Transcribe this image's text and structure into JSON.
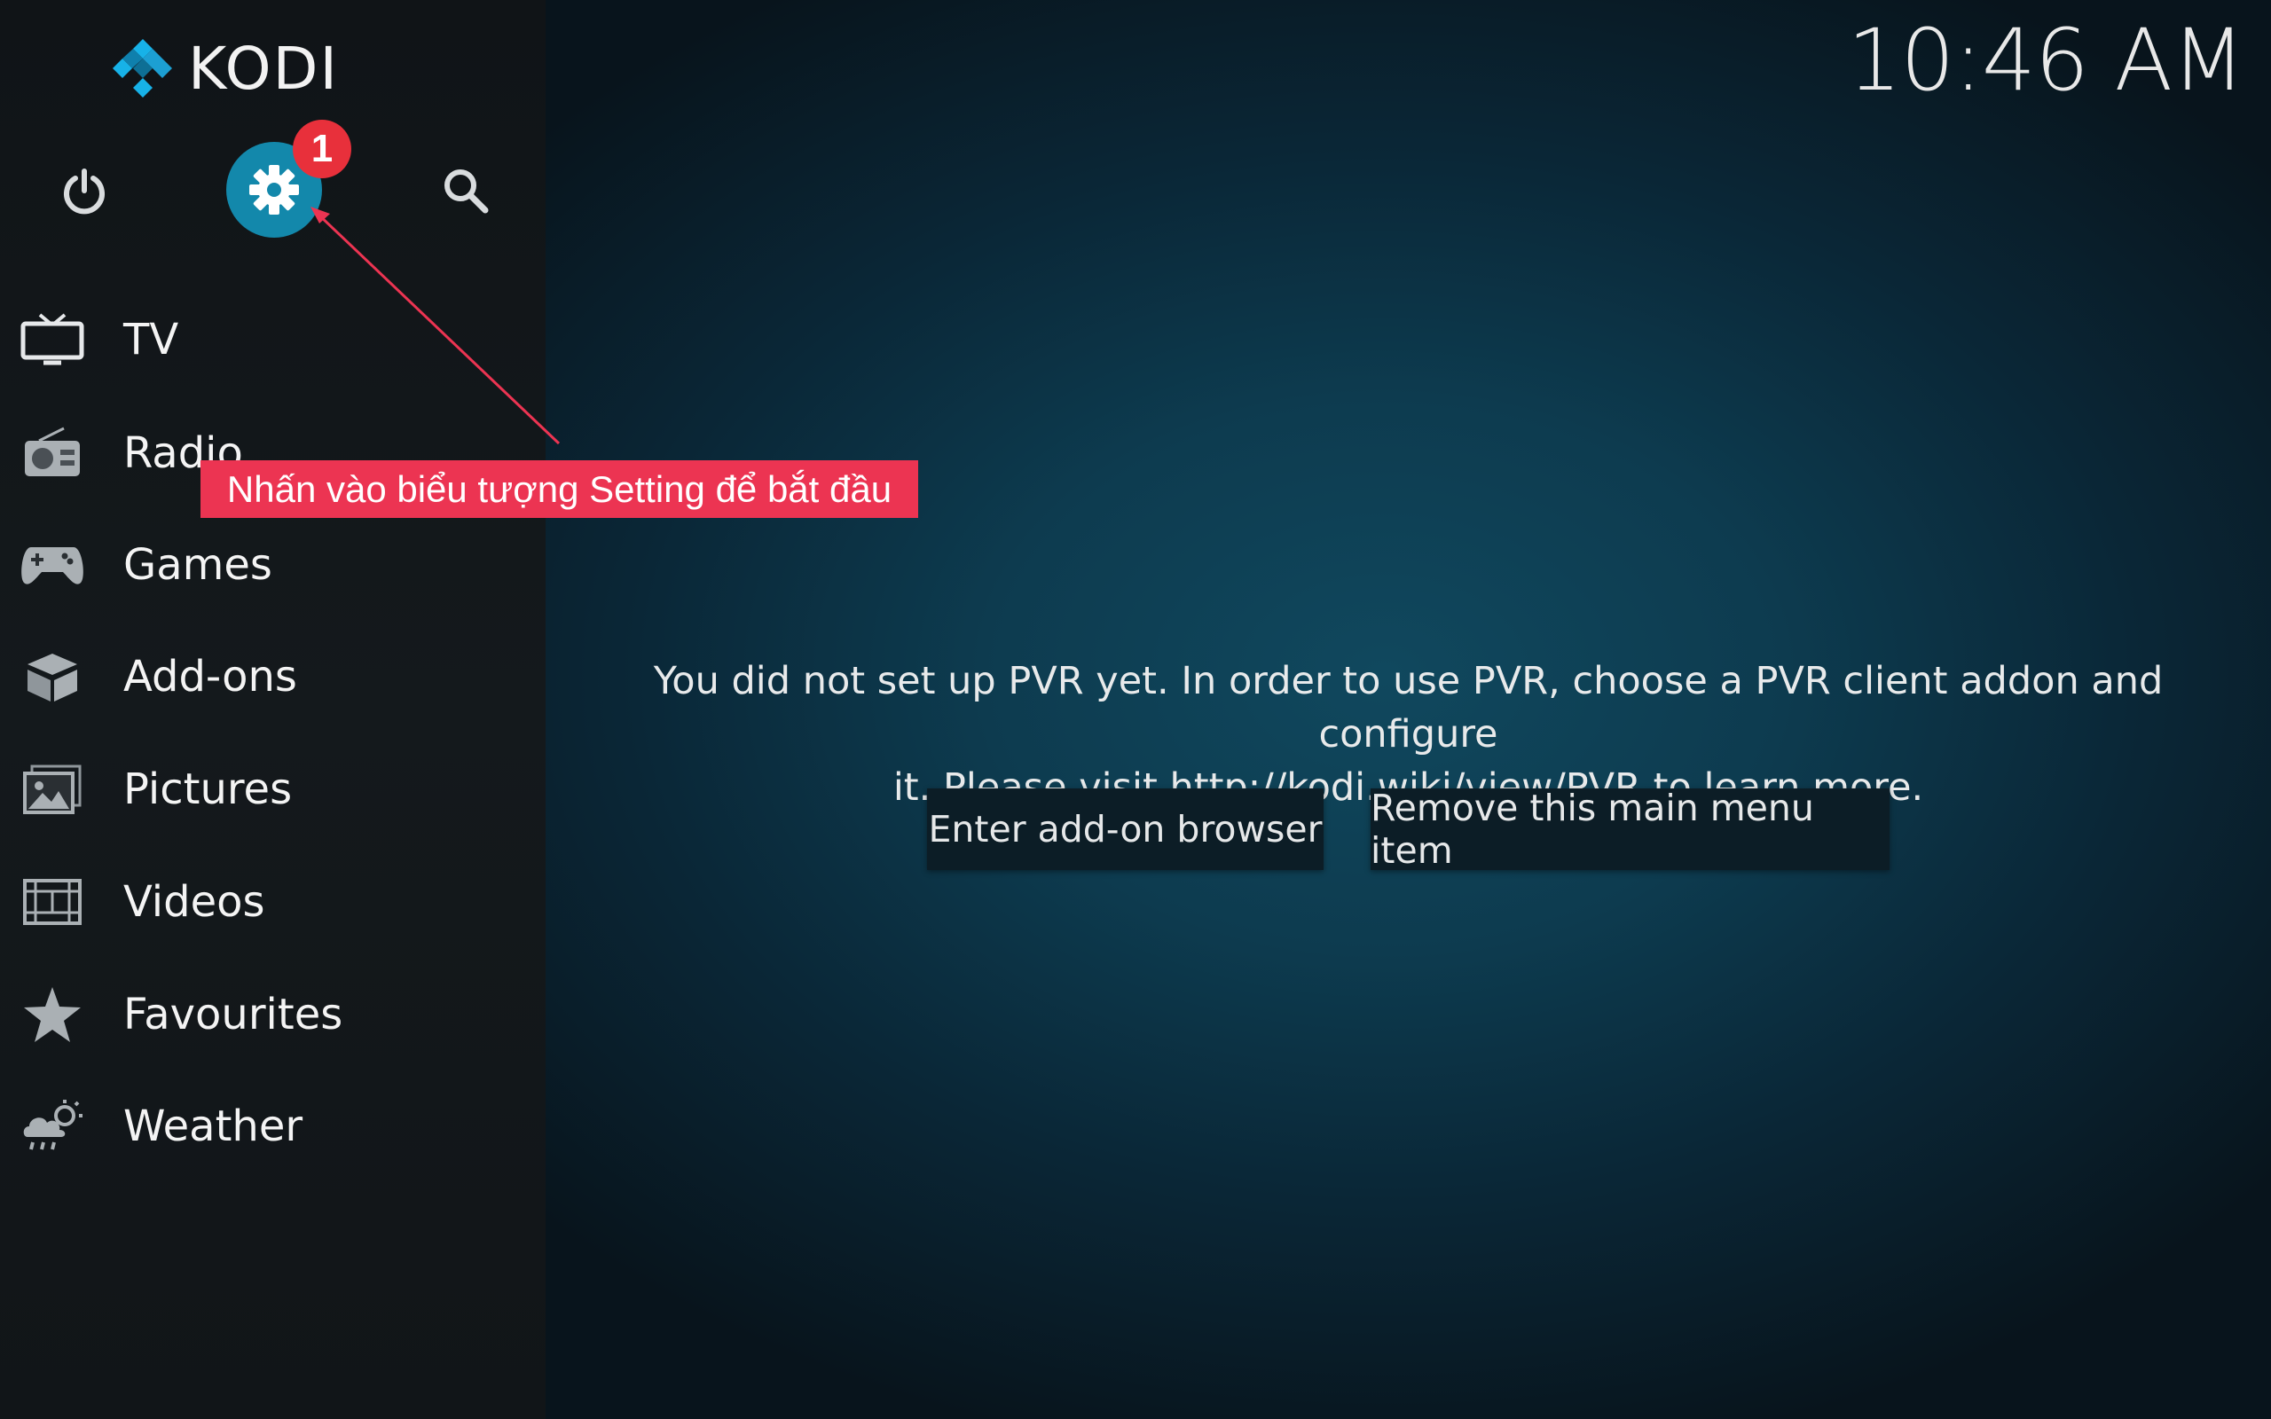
{
  "app": {
    "logo_text": "KODI",
    "clock": "10:46 AM"
  },
  "top_icons": {
    "power": "power-icon",
    "settings": "gear-icon",
    "search": "search-icon"
  },
  "annotation": {
    "badge": "1",
    "callout": "Nhấn vào biểu tượng Setting để bắt đầu",
    "color": "#ec3452"
  },
  "menu": {
    "items": [
      {
        "label": "TV",
        "icon": "tv-icon"
      },
      {
        "label": "Radio",
        "icon": "radio-icon"
      },
      {
        "label": "Games",
        "icon": "gamepad-icon"
      },
      {
        "label": "Add-ons",
        "icon": "addons-box-icon"
      },
      {
        "label": "Pictures",
        "icon": "pictures-icon"
      },
      {
        "label": "Videos",
        "icon": "film-icon"
      },
      {
        "label": "Favourites",
        "icon": "star-icon"
      },
      {
        "label": "Weather",
        "icon": "weather-icon"
      }
    ]
  },
  "main": {
    "message_line1": "You did not set up PVR yet. In order to use PVR, choose a PVR client addon and configure",
    "message_line2": "it. Please visit http://kodi.wiki/view/PVR to learn more.",
    "buttons": {
      "addon_browser": "Enter add-on browser",
      "remove_item": "Remove this main menu item"
    }
  },
  "colors": {
    "accent": "#1388ab",
    "badge": "#e8303b",
    "sidebar": "#14191c"
  }
}
